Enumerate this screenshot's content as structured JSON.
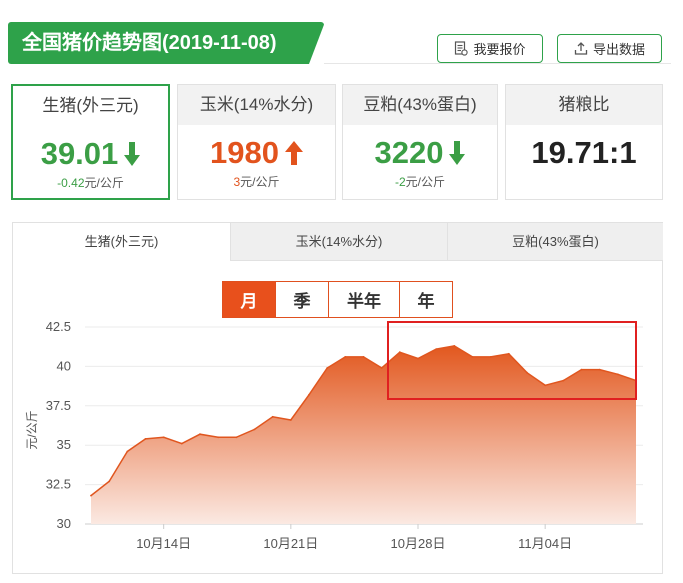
{
  "header": {
    "title": "全国猪价趋势图(2019-11-08)"
  },
  "actions": {
    "report_label": "我要报价",
    "export_label": "导出数据"
  },
  "cards": [
    {
      "name": "生猪(外三元)",
      "value": "39.01",
      "change": "-0.42",
      "unit": "元/公斤",
      "direction": "down",
      "color": "#3b9e45"
    },
    {
      "name": "玉米(14%水分)",
      "value": "1980",
      "change": "3",
      "unit": "元/公斤",
      "direction": "up",
      "color": "#e2531d"
    },
    {
      "name": "豆粕(43%蛋白)",
      "value": "3220",
      "change": "-2",
      "unit": "元/公斤",
      "direction": "down",
      "color": "#3b9e45"
    },
    {
      "name": "猪粮比",
      "value": "19.71:1"
    }
  ],
  "tabs": [
    "生猪(外三元)",
    "玉米(14%水分)",
    "豆粕(43%蛋白)"
  ],
  "periods": [
    "月",
    "季",
    "半年",
    "年"
  ],
  "chart_data": {
    "type": "area",
    "ylabel": "元/公斤",
    "ylim": [
      30,
      42.5
    ],
    "yticks": [
      30,
      32.5,
      35,
      37.5,
      40,
      42.5
    ],
    "x_tick_labels": [
      "10月14日",
      "10月21日",
      "10月28日",
      "11月04日"
    ],
    "x_tick_index": [
      4,
      11,
      18,
      25
    ],
    "values": [
      31.8,
      32.7,
      34.6,
      35.4,
      35.5,
      35.1,
      35.7,
      35.5,
      35.5,
      36.0,
      36.8,
      36.6,
      38.2,
      39.9,
      40.6,
      40.6,
      39.9,
      40.9,
      40.5,
      41.1,
      41.3,
      40.6,
      40.6,
      40.8,
      39.6,
      38.8,
      39.1,
      39.8,
      39.8,
      39.5,
      39.1
    ],
    "colors": {
      "line": "#e0561f",
      "fill_top": "#e2581f",
      "fill_bottom": "#fbe9e2",
      "highlight": "#e02020"
    }
  }
}
